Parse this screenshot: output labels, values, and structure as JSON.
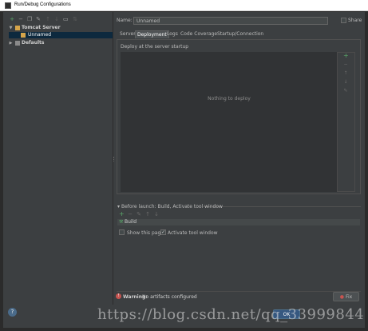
{
  "window": {
    "title": "Run/Debug Configurations"
  },
  "toolbar": {
    "icons": [
      "add-icon",
      "remove-icon",
      "copy-icon",
      "settings-icon",
      "move-up-icon",
      "move-down-icon",
      "folder-icon",
      "sort-icon"
    ]
  },
  "tree": {
    "items": [
      {
        "label": "Tomcat Server",
        "expanded": true
      },
      {
        "label": "Unnamed",
        "selected": true
      },
      {
        "label": "Defaults",
        "expanded": false
      }
    ]
  },
  "form": {
    "name_label": "Name:",
    "name_value": "Unnamed",
    "share_label": "Share"
  },
  "tabs": [
    {
      "label": "Server",
      "active": false
    },
    {
      "label": "Deployment",
      "active": true
    },
    {
      "label": "Logs",
      "active": false
    },
    {
      "label": "Code Coverage",
      "active": false
    },
    {
      "label": "Startup/Connection",
      "active": false
    }
  ],
  "deployment": {
    "section_title": "Deploy at the server startup",
    "empty_text": "Nothing to deploy"
  },
  "before_launch": {
    "title": "Before launch: Build, Activate tool window",
    "items": [
      "Build"
    ],
    "show_page_label": "Show this page",
    "activate_label": "Activate tool window"
  },
  "footer": {
    "warning_bold": "Warning:",
    "warning_text": " No artifacts configured",
    "fix_label": "Fix",
    "ok_label": "OK",
    "help_glyph": "?"
  },
  "watermark": "https://blog.csdn.net/qq_33999844",
  "colors": {
    "background": "#3c3f41",
    "selection": "#0d293e",
    "accent_green": "#59a869",
    "warning_red": "#c75450"
  }
}
